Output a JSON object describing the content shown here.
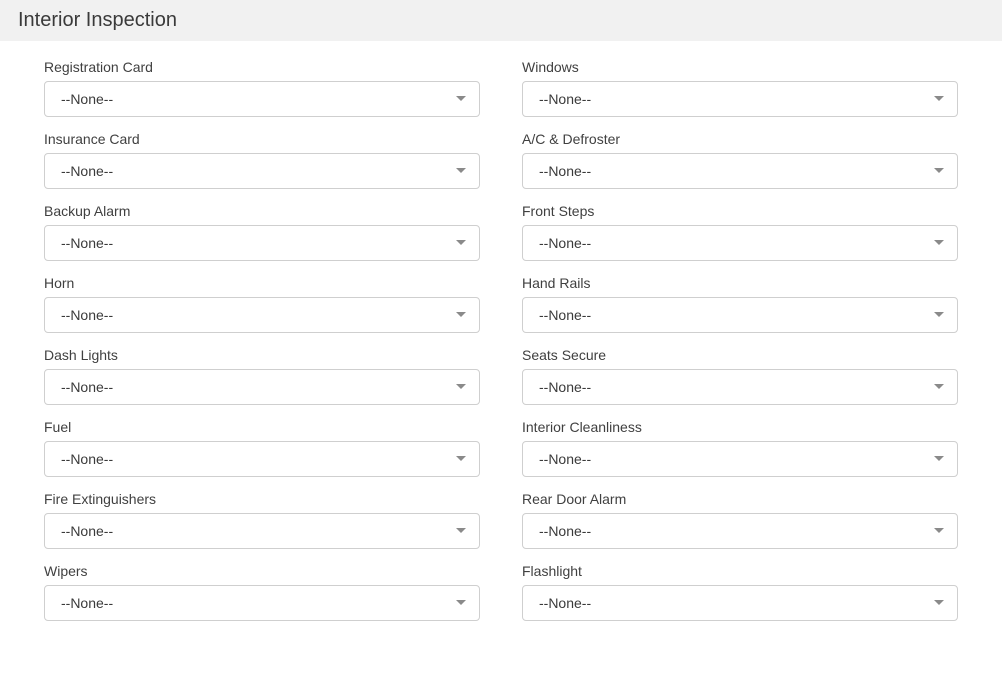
{
  "section": {
    "title": "Interior Inspection"
  },
  "defaults": {
    "none": "--None--"
  },
  "fields": {
    "left": [
      {
        "label": "Registration Card",
        "value": "--None--",
        "name": "registration-card"
      },
      {
        "label": "Insurance Card",
        "value": "--None--",
        "name": "insurance-card"
      },
      {
        "label": "Backup Alarm",
        "value": "--None--",
        "name": "backup-alarm"
      },
      {
        "label": "Horn",
        "value": "--None--",
        "name": "horn"
      },
      {
        "label": "Dash Lights",
        "value": "--None--",
        "name": "dash-lights"
      },
      {
        "label": "Fuel",
        "value": "--None--",
        "name": "fuel"
      },
      {
        "label": "Fire Extinguishers",
        "value": "--None--",
        "name": "fire-extinguishers"
      },
      {
        "label": "Wipers",
        "value": "--None--",
        "name": "wipers"
      }
    ],
    "right": [
      {
        "label": "Windows",
        "value": "--None--",
        "name": "windows"
      },
      {
        "label": "A/C & Defroster",
        "value": "--None--",
        "name": "ac-defroster"
      },
      {
        "label": "Front Steps",
        "value": "--None--",
        "name": "front-steps"
      },
      {
        "label": "Hand Rails",
        "value": "--None--",
        "name": "hand-rails"
      },
      {
        "label": "Seats Secure",
        "value": "--None--",
        "name": "seats-secure"
      },
      {
        "label": "Interior Cleanliness",
        "value": "--None--",
        "name": "interior-cleanliness"
      },
      {
        "label": "Rear Door Alarm",
        "value": "--None--",
        "name": "rear-door-alarm"
      },
      {
        "label": "Flashlight",
        "value": "--None--",
        "name": "flashlight"
      }
    ]
  }
}
